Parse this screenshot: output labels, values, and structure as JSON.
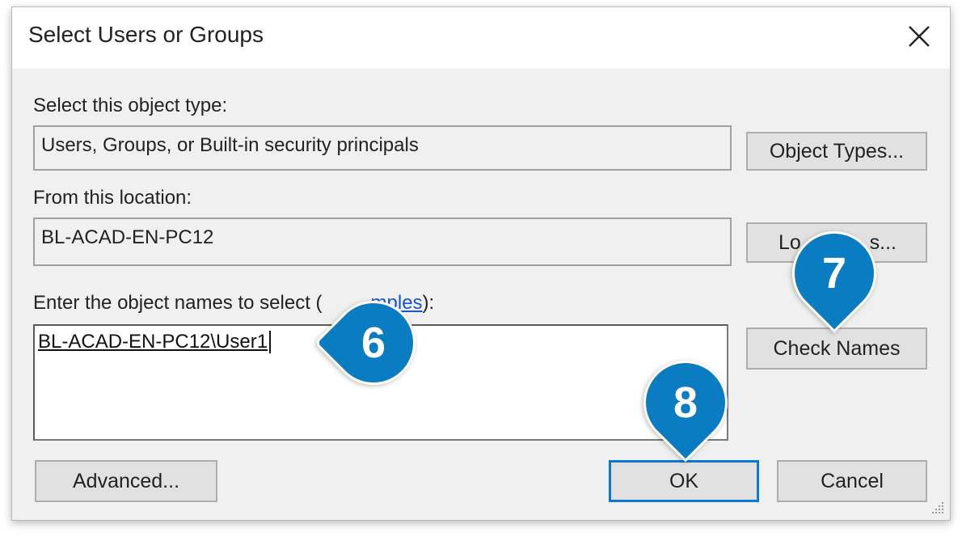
{
  "dialog": {
    "title": "Select Users or Groups",
    "object_type": {
      "label": "Select this object type:",
      "value": "Users, Groups, or Built-in security principals",
      "button": "Object Types..."
    },
    "location": {
      "label": "From this location:",
      "value": "BL-ACAD-EN-PC12",
      "button_visible_start": "Lo",
      "button_visible_end": "s..."
    },
    "names": {
      "label_prefix": "Enter the object names to select (",
      "label_link_visible": "mples",
      "label_suffix": "):",
      "value": "BL-ACAD-EN-PC12\\User1",
      "check_button": "Check Names"
    },
    "buttons": {
      "advanced": "Advanced...",
      "ok": "OK",
      "cancel": "Cancel"
    }
  },
  "callouts": [
    "6",
    "7",
    "8"
  ],
  "colors": {
    "callout": "#0a7cc2",
    "default_button_border": "#0a78d7",
    "dialog_bg": "#f0f0f0"
  },
  "icons": [
    "close-icon",
    "resize-grip-icon"
  ]
}
